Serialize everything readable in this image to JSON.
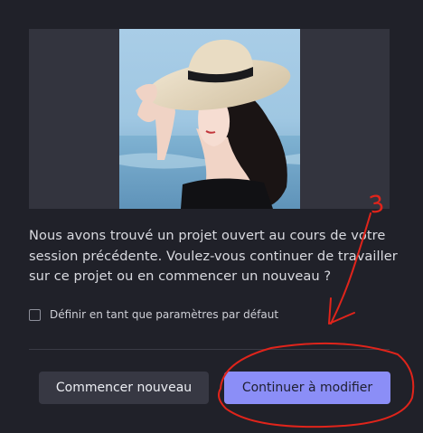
{
  "dialog": {
    "message": "Nous avons trouvé un projet ouvert au cours de votre session précédente. Voulez-vous continuer de travailler sur ce projet ou en commencer un nouveau ?",
    "default_checkbox_label": "Définir en tant que paramètres par défaut",
    "default_checkbox_checked": false,
    "new_button_label": "Commencer nouveau",
    "continue_button_label": "Continuer à modifier",
    "continue_button_color": "#8b8ef7"
  },
  "annotation": {
    "step_number": "3",
    "color": "#e0241b"
  }
}
